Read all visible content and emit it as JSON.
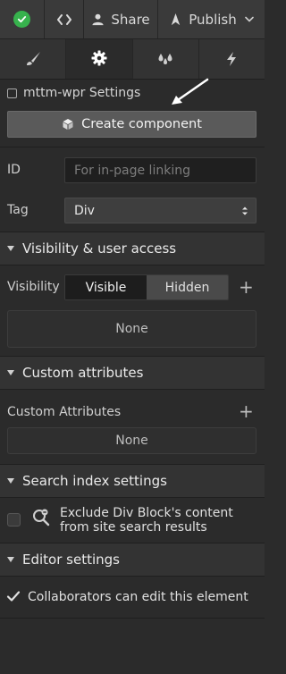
{
  "topbar": {
    "share_label": "Share",
    "publish_label": "Publish"
  },
  "tabs": [
    "style-tab",
    "settings-tab",
    "interactions-tab",
    "lightning-tab"
  ],
  "component": {
    "settings_label": "mttm-wpr Settings",
    "create_button": "Create component"
  },
  "fields": {
    "id_label": "ID",
    "id_placeholder": "For in-page linking",
    "tag_label": "Tag",
    "tag_value": "Div"
  },
  "visibility": {
    "section_title": "Visibility & user access",
    "label": "Visibility",
    "options": [
      "Visible",
      "Hidden"
    ],
    "selected": "Visible",
    "none_text": "None"
  },
  "custom_attributes": {
    "section_title": "Custom attributes",
    "label": "Custom Attributes",
    "none_text": "None"
  },
  "search_index": {
    "section_title": "Search index settings",
    "exclude_line1": "Exclude Div Block's content",
    "exclude_line2": "from site search results",
    "checked": false
  },
  "editor": {
    "section_title": "Editor settings",
    "collaborators_label": "Collaborators can edit this element",
    "checked": true
  },
  "colors": {
    "status_green": "#37b24d",
    "panel_bg": "#2b2b2b",
    "button_bg": "#5a5a5a"
  }
}
